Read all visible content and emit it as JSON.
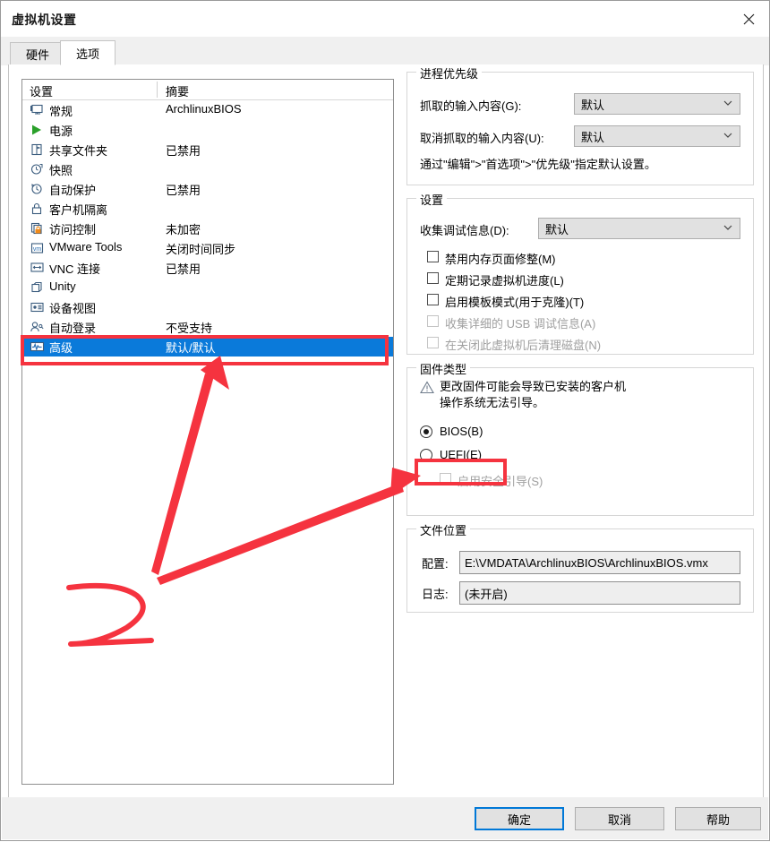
{
  "window": {
    "title": "虚拟机设置",
    "close_icon": "close-icon"
  },
  "tabs": [
    {
      "label": "硬件",
      "active": false
    },
    {
      "label": "选项",
      "active": true
    }
  ],
  "settings_list": {
    "columns": [
      "设置",
      "摘要"
    ],
    "rows": [
      {
        "icon": "monitor-icon",
        "name": "常规",
        "summary": "ArchlinuxBIOS",
        "selected": false
      },
      {
        "icon": "power-play-icon",
        "name": "电源",
        "summary": "",
        "selected": false
      },
      {
        "icon": "folder-icon",
        "name": "共享文件夹",
        "summary": "已禁用",
        "selected": false
      },
      {
        "icon": "snapshot-icon",
        "name": "快照",
        "summary": "",
        "selected": false
      },
      {
        "icon": "autoprotect-icon",
        "name": "自动保护",
        "summary": "已禁用",
        "selected": false
      },
      {
        "icon": "lock-icon",
        "name": "客户机隔离",
        "summary": "",
        "selected": false
      },
      {
        "icon": "access-lock-icon",
        "name": "访问控制",
        "summary": "未加密",
        "selected": false
      },
      {
        "icon": "vmware-tools-icon",
        "name": "VMware Tools",
        "summary": "关闭时间同步",
        "selected": false
      },
      {
        "icon": "vnc-icon",
        "name": "VNC 连接",
        "summary": "已禁用",
        "selected": false
      },
      {
        "icon": "unity-icon",
        "name": "Unity",
        "summary": "",
        "selected": false
      },
      {
        "icon": "deviceview-icon",
        "name": "设备视图",
        "summary": "",
        "selected": false
      },
      {
        "icon": "autologin-icon",
        "name": "自动登录",
        "summary": "不受支持",
        "selected": false
      },
      {
        "icon": "advanced-icon",
        "name": "高级",
        "summary": "默认/默认",
        "selected": true
      }
    ]
  },
  "process_priority": {
    "legend": "进程优先级",
    "grab_label": "抓取的输入内容(G):",
    "grab_value": "默认",
    "ungrab_label": "取消抓取的输入内容(U):",
    "ungrab_value": "默认",
    "note": "通过\"编辑\">\"首选项\">\"优先级\"指定默认设置。"
  },
  "settings_group": {
    "legend": "设置",
    "debug_label": "收集调试信息(D):",
    "debug_value": "默认",
    "checkboxes": [
      {
        "label": "禁用内存页面修整(M)",
        "checked": false,
        "disabled": false
      },
      {
        "label": "定期记录虚拟机进度(L)",
        "checked": false,
        "disabled": false
      },
      {
        "label": "启用模板模式(用于克隆)(T)",
        "checked": false,
        "disabled": false
      },
      {
        "label": "收集详细的 USB 调试信息(A)",
        "checked": false,
        "disabled": true
      },
      {
        "label": "在关闭此虚拟机后清理磁盘(N)",
        "checked": false,
        "disabled": true
      }
    ]
  },
  "firmware": {
    "legend": "固件类型",
    "warning_icon": "warning-triangle-icon",
    "warning_line1": "更改固件可能会导致已安装的客户机",
    "warning_line2": "操作系统无法引导。",
    "options": [
      {
        "label": "BIOS(B)",
        "selected": true,
        "disabled": false
      },
      {
        "label": "UEFI(E)",
        "selected": false,
        "disabled": false
      }
    ],
    "secureboot": {
      "label": "启用安全引导(S)",
      "checked": false,
      "disabled": true
    }
  },
  "file_location": {
    "legend": "文件位置",
    "config_label": "配置:",
    "config_value": "E:\\VMDATA\\ArchlinuxBIOS\\ArchlinuxBIOS.vmx",
    "log_label": "日志:",
    "log_value": "(未开启)"
  },
  "footer": {
    "ok": "确定",
    "cancel": "取消",
    "help": "帮助"
  },
  "annotations": {
    "accent_color": "#f5333f",
    "selection_color": "#0a7ada",
    "marks": [
      "box-around-advanced-row",
      "box-around-bios-radio",
      "arrow-to-advanced-row",
      "arrow-to-bios-radio",
      "handwritten-2"
    ],
    "handwritten_label": "2"
  }
}
